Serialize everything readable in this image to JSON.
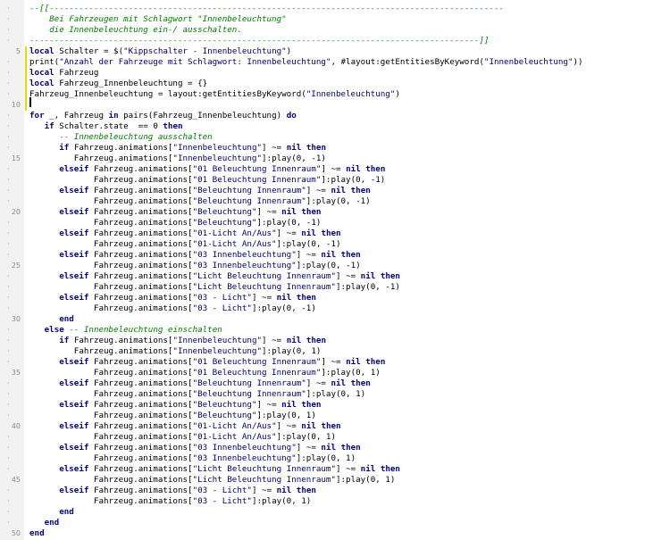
{
  "editor": {
    "colors": {
      "gutter_bg": "#f2f2f2",
      "gutter_text": "#8a8a8a",
      "change_marker": "#e6d800",
      "keyword": "#00008b",
      "string": "#000080",
      "comment": "#007f00",
      "text": "#000000"
    },
    "lines": [
      {
        "num": "",
        "tokens": [
          [
            "cmt",
            "--[[--------------------------------------------------------------------------------------------"
          ]
        ]
      },
      {
        "num": "",
        "tokens": [
          [
            "cmt",
            "    Bei Fahrzeugen mit Schlagwort \"Innenbeleuchtung\""
          ]
        ]
      },
      {
        "num": "",
        "tokens": [
          [
            "cmt",
            "    die Innenbeleuchtung ein-/ ausschalten."
          ]
        ]
      },
      {
        "num": "",
        "tokens": [
          [
            "cmt",
            "-------------------------------------------------------------------------------------------]]"
          ]
        ]
      },
      {
        "num": "5",
        "changed": true,
        "tokens": [
          [
            "kw",
            "local"
          ],
          [
            "txt",
            " Schalter = $("
          ],
          [
            "str",
            "\"Kippschalter - Innenbeleuchtung\""
          ],
          [
            "txt",
            ")"
          ]
        ]
      },
      {
        "num": "",
        "changed": true,
        "tokens": [
          [
            "txt",
            "print("
          ],
          [
            "str",
            "\"Anzahl der Fahrzeuge mit Schlagwort: Innenbeleuchtung\""
          ],
          [
            "txt",
            ", #layout:getEntitiesByKeyword("
          ],
          [
            "str",
            "\"Innenbeleuchtung\""
          ],
          [
            "txt",
            "))"
          ]
        ]
      },
      {
        "num": "",
        "changed": true,
        "tokens": [
          [
            "kw",
            "local"
          ],
          [
            "txt",
            " Fahrzeug"
          ]
        ]
      },
      {
        "num": "",
        "changed": true,
        "tokens": [
          [
            "kw",
            "local"
          ],
          [
            "txt",
            " Fahrzeug_Innenbeleuchtung = {}"
          ]
        ]
      },
      {
        "num": "",
        "changed": true,
        "tokens": [
          [
            "txt",
            "Fahrzeug_Innenbeleuchtung = layout:getEntitiesByKeyword("
          ],
          [
            "str",
            "\"Innenbeleuchtung\""
          ],
          [
            "txt",
            ")"
          ]
        ]
      },
      {
        "num": "10",
        "changed": true,
        "tokens": []
      },
      {
        "num": "",
        "tokens": [
          [
            "kw",
            "for"
          ],
          [
            "txt",
            " _, Fahrzeug "
          ],
          [
            "kw",
            "in"
          ],
          [
            "txt",
            " pairs(Fahrzeug_Innenbeleuchtung) "
          ],
          [
            "kw",
            "do"
          ]
        ]
      },
      {
        "num": "",
        "tokens": [
          [
            "txt",
            "   "
          ],
          [
            "kw",
            "if"
          ],
          [
            "txt",
            " Schalter.state  == 0 "
          ],
          [
            "kw",
            "then"
          ]
        ]
      },
      {
        "num": "",
        "tokens": [
          [
            "txt",
            "      "
          ],
          [
            "cmt",
            "-- Innenbeleuchtung ausschalten"
          ]
        ]
      },
      {
        "num": "",
        "tokens": [
          [
            "txt",
            "      "
          ],
          [
            "kw",
            "if"
          ],
          [
            "txt",
            " Fahrzeug.animations["
          ],
          [
            "str",
            "\"Innenbeleuchtung\""
          ],
          [
            "txt",
            "] ~= "
          ],
          [
            "kw",
            "nil"
          ],
          [
            "txt",
            " "
          ],
          [
            "kw",
            "then"
          ]
        ]
      },
      {
        "num": "15",
        "tokens": [
          [
            "txt",
            "         Fahrzeug.animations["
          ],
          [
            "str",
            "\"Innenbeleuchtung\""
          ],
          [
            "txt",
            "]:play(0, -1)"
          ]
        ]
      },
      {
        "num": "",
        "tokens": [
          [
            "txt",
            "      "
          ],
          [
            "kw",
            "elseif"
          ],
          [
            "txt",
            " Fahrzeug.animations["
          ],
          [
            "str",
            "\"01 Beleuchtung Innenraum\""
          ],
          [
            "txt",
            "] ~= "
          ],
          [
            "kw",
            "nil"
          ],
          [
            "txt",
            " "
          ],
          [
            "kw",
            "then"
          ]
        ]
      },
      {
        "num": "",
        "tokens": [
          [
            "txt",
            "             Fahrzeug.animations["
          ],
          [
            "str",
            "\"01 Beleuchtung Innenraum\""
          ],
          [
            "txt",
            "]:play(0, -1)"
          ]
        ]
      },
      {
        "num": "",
        "tokens": [
          [
            "txt",
            "      "
          ],
          [
            "kw",
            "elseif"
          ],
          [
            "txt",
            " Fahrzeug.animations["
          ],
          [
            "str",
            "\"Beleuchtung Innenraum\""
          ],
          [
            "txt",
            "] ~= "
          ],
          [
            "kw",
            "nil"
          ],
          [
            "txt",
            " "
          ],
          [
            "kw",
            "then"
          ]
        ]
      },
      {
        "num": "",
        "tokens": [
          [
            "txt",
            "             Fahrzeug.animations["
          ],
          [
            "str",
            "\"Beleuchtung Innenraum\""
          ],
          [
            "txt",
            "]:play(0, -1)"
          ]
        ]
      },
      {
        "num": "20",
        "tokens": [
          [
            "txt",
            "      "
          ],
          [
            "kw",
            "elseif"
          ],
          [
            "txt",
            " Fahrzeug.animations["
          ],
          [
            "str",
            "\"Beleuchtung\""
          ],
          [
            "txt",
            "] ~= "
          ],
          [
            "kw",
            "nil"
          ],
          [
            "txt",
            " "
          ],
          [
            "kw",
            "then"
          ]
        ]
      },
      {
        "num": "",
        "tokens": [
          [
            "txt",
            "             Fahrzeug.animations["
          ],
          [
            "str",
            "\"Beleuchtung\""
          ],
          [
            "txt",
            "]:play(0, -1)"
          ]
        ]
      },
      {
        "num": "",
        "tokens": [
          [
            "txt",
            "      "
          ],
          [
            "kw",
            "elseif"
          ],
          [
            "txt",
            " Fahrzeug.animations["
          ],
          [
            "str",
            "\"01-Licht An/Aus\""
          ],
          [
            "txt",
            "] ~= "
          ],
          [
            "kw",
            "nil"
          ],
          [
            "txt",
            " "
          ],
          [
            "kw",
            "then"
          ]
        ]
      },
      {
        "num": "",
        "tokens": [
          [
            "txt",
            "             Fahrzeug.animations["
          ],
          [
            "str",
            "\"01-Licht An/Aus\""
          ],
          [
            "txt",
            "]:play(0, -1)"
          ]
        ]
      },
      {
        "num": "",
        "tokens": [
          [
            "txt",
            "      "
          ],
          [
            "kw",
            "elseif"
          ],
          [
            "txt",
            " Fahrzeug.animations["
          ],
          [
            "str",
            "\"03 Innenbeleuchtung\""
          ],
          [
            "txt",
            "] ~= "
          ],
          [
            "kw",
            "nil"
          ],
          [
            "txt",
            " "
          ],
          [
            "kw",
            "then"
          ]
        ]
      },
      {
        "num": "25",
        "tokens": [
          [
            "txt",
            "             Fahrzeug.animations["
          ],
          [
            "str",
            "\"03 Innenbeleuchtung\""
          ],
          [
            "txt",
            "]:play(0, -1)"
          ]
        ]
      },
      {
        "num": "",
        "tokens": [
          [
            "txt",
            "      "
          ],
          [
            "kw",
            "elseif"
          ],
          [
            "txt",
            " Fahrzeug.animations["
          ],
          [
            "str",
            "\"Licht Beleuchtung Innenraum\""
          ],
          [
            "txt",
            "] ~= "
          ],
          [
            "kw",
            "nil"
          ],
          [
            "txt",
            " "
          ],
          [
            "kw",
            "then"
          ]
        ]
      },
      {
        "num": "",
        "tokens": [
          [
            "txt",
            "             Fahrzeug.animations["
          ],
          [
            "str",
            "\"Licht Beleuchtung Innenraum\""
          ],
          [
            "txt",
            "]:play(0, -1)"
          ]
        ]
      },
      {
        "num": "",
        "tokens": [
          [
            "txt",
            "      "
          ],
          [
            "kw",
            "elseif"
          ],
          [
            "txt",
            " Fahrzeug.animations["
          ],
          [
            "str",
            "\"03 - Licht\""
          ],
          [
            "txt",
            "] ~= "
          ],
          [
            "kw",
            "nil"
          ],
          [
            "txt",
            " "
          ],
          [
            "kw",
            "then"
          ]
        ]
      },
      {
        "num": "",
        "tokens": [
          [
            "txt",
            "             Fahrzeug.animations["
          ],
          [
            "str",
            "\"03 - Licht\""
          ],
          [
            "txt",
            "]:play(0, -1)"
          ]
        ]
      },
      {
        "num": "30",
        "tokens": [
          [
            "txt",
            "      "
          ],
          [
            "kw",
            "end"
          ]
        ]
      },
      {
        "num": "",
        "tokens": [
          [
            "txt",
            "   "
          ],
          [
            "kw",
            "else"
          ],
          [
            "txt",
            " "
          ],
          [
            "cmt",
            "-- Innenbeleuchtung einschalten"
          ]
        ]
      },
      {
        "num": "",
        "tokens": [
          [
            "txt",
            "      "
          ],
          [
            "kw",
            "if"
          ],
          [
            "txt",
            " Fahrzeug.animations["
          ],
          [
            "str",
            "\"Innenbeleuchtung\""
          ],
          [
            "txt",
            "] ~= "
          ],
          [
            "kw",
            "nil"
          ],
          [
            "txt",
            " "
          ],
          [
            "kw",
            "then"
          ]
        ]
      },
      {
        "num": "",
        "tokens": [
          [
            "txt",
            "         Fahrzeug.animations["
          ],
          [
            "str",
            "\"Innenbeleuchtung\""
          ],
          [
            "txt",
            "]:play(0, 1)"
          ]
        ]
      },
      {
        "num": "",
        "tokens": [
          [
            "txt",
            "      "
          ],
          [
            "kw",
            "elseif"
          ],
          [
            "txt",
            " Fahrzeug.animations["
          ],
          [
            "str",
            "\"01 Beleuchtung Innenraum\""
          ],
          [
            "txt",
            "] ~= "
          ],
          [
            "kw",
            "nil"
          ],
          [
            "txt",
            " "
          ],
          [
            "kw",
            "then"
          ]
        ]
      },
      {
        "num": "35",
        "tokens": [
          [
            "txt",
            "             Fahrzeug.animations["
          ],
          [
            "str",
            "\"01 Beleuchtung Innenraum\""
          ],
          [
            "txt",
            "]:play(0, 1)"
          ]
        ]
      },
      {
        "num": "",
        "tokens": [
          [
            "txt",
            "      "
          ],
          [
            "kw",
            "elseif"
          ],
          [
            "txt",
            " Fahrzeug.animations["
          ],
          [
            "str",
            "\"Beleuchtung Innenraum\""
          ],
          [
            "txt",
            "] ~= "
          ],
          [
            "kw",
            "nil"
          ],
          [
            "txt",
            " "
          ],
          [
            "kw",
            "then"
          ]
        ]
      },
      {
        "num": "",
        "tokens": [
          [
            "txt",
            "             Fahrzeug.animations["
          ],
          [
            "str",
            "\"Beleuchtung Innenraum\""
          ],
          [
            "txt",
            "]:play(0, 1)"
          ]
        ]
      },
      {
        "num": "",
        "tokens": [
          [
            "txt",
            "      "
          ],
          [
            "kw",
            "elseif"
          ],
          [
            "txt",
            " Fahrzeug.animations["
          ],
          [
            "str",
            "\"Beleuchtung\""
          ],
          [
            "txt",
            "] ~= "
          ],
          [
            "kw",
            "nil"
          ],
          [
            "txt",
            " "
          ],
          [
            "kw",
            "then"
          ]
        ]
      },
      {
        "num": "",
        "tokens": [
          [
            "txt",
            "             Fahrzeug.animations["
          ],
          [
            "str",
            "\"Beleuchtung\""
          ],
          [
            "txt",
            "]:play(0, 1)"
          ]
        ]
      },
      {
        "num": "40",
        "tokens": [
          [
            "txt",
            "      "
          ],
          [
            "kw",
            "elseif"
          ],
          [
            "txt",
            " Fahrzeug.animations["
          ],
          [
            "str",
            "\"01-Licht An/Aus\""
          ],
          [
            "txt",
            "] ~= "
          ],
          [
            "kw",
            "nil"
          ],
          [
            "txt",
            " "
          ],
          [
            "kw",
            "then"
          ]
        ]
      },
      {
        "num": "",
        "tokens": [
          [
            "txt",
            "             Fahrzeug.animations["
          ],
          [
            "str",
            "\"01-Licht An/Aus\""
          ],
          [
            "txt",
            "]:play(0, 1)"
          ]
        ]
      },
      {
        "num": "",
        "tokens": [
          [
            "txt",
            "      "
          ],
          [
            "kw",
            "elseif"
          ],
          [
            "txt",
            " Fahrzeug.animations["
          ],
          [
            "str",
            "\"03 Innenbeleuchtung\""
          ],
          [
            "txt",
            "] ~= "
          ],
          [
            "kw",
            "nil"
          ],
          [
            "txt",
            " "
          ],
          [
            "kw",
            "then"
          ]
        ]
      },
      {
        "num": "",
        "tokens": [
          [
            "txt",
            "             Fahrzeug.animations["
          ],
          [
            "str",
            "\"03 Innenbeleuchtung\""
          ],
          [
            "txt",
            "]:play(0, 1)"
          ]
        ]
      },
      {
        "num": "",
        "tokens": [
          [
            "txt",
            "      "
          ],
          [
            "kw",
            "elseif"
          ],
          [
            "txt",
            " Fahrzeug.animations["
          ],
          [
            "str",
            "\"Licht Beleuchtung Innenraum\""
          ],
          [
            "txt",
            "] ~= "
          ],
          [
            "kw",
            "nil"
          ],
          [
            "txt",
            " "
          ],
          [
            "kw",
            "then"
          ]
        ]
      },
      {
        "num": "45",
        "tokens": [
          [
            "txt",
            "             Fahrzeug.animations["
          ],
          [
            "str",
            "\"Licht Beleuchtung Innenraum\""
          ],
          [
            "txt",
            "]:play(0, 1)"
          ]
        ]
      },
      {
        "num": "",
        "tokens": [
          [
            "txt",
            "      "
          ],
          [
            "kw",
            "elseif"
          ],
          [
            "txt",
            " Fahrzeug.animations["
          ],
          [
            "str",
            "\"03 - Licht\""
          ],
          [
            "txt",
            "] ~= "
          ],
          [
            "kw",
            "nil"
          ],
          [
            "txt",
            " "
          ],
          [
            "kw",
            "then"
          ]
        ]
      },
      {
        "num": "",
        "tokens": [
          [
            "txt",
            "             Fahrzeug.animations["
          ],
          [
            "str",
            "\"03 - Licht\""
          ],
          [
            "txt",
            "]:play(0, 1)"
          ]
        ]
      },
      {
        "num": "",
        "tokens": [
          [
            "txt",
            "      "
          ],
          [
            "kw",
            "end"
          ]
        ]
      },
      {
        "num": "",
        "tokens": [
          [
            "txt",
            "   "
          ],
          [
            "kw",
            "end"
          ]
        ]
      },
      {
        "num": "50",
        "tokens": [
          [
            "kw",
            "end"
          ]
        ]
      }
    ]
  }
}
